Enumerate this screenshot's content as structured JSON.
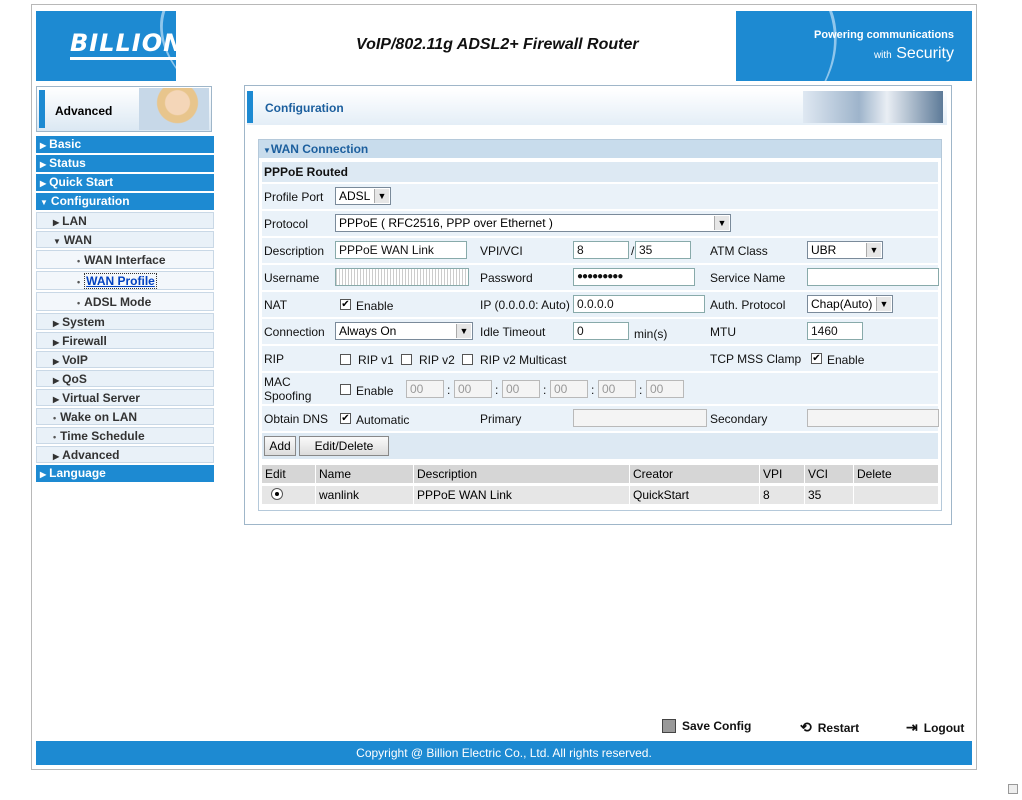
{
  "header": {
    "logo": "BILLION",
    "title": "VoIP/802.11g ADSL2+ Firewall Router",
    "tagline_line1": "Powering communications",
    "tagline_with": "with",
    "tagline_security": "Security"
  },
  "sidebar": {
    "mode_label": "Advanced",
    "items": [
      {
        "label": "Basic"
      },
      {
        "label": "Status"
      },
      {
        "label": "Quick Start"
      },
      {
        "label": "Configuration"
      },
      {
        "label": "LAN"
      },
      {
        "label": "WAN"
      },
      {
        "label": "WAN Interface"
      },
      {
        "label": "WAN Profile"
      },
      {
        "label": "ADSL Mode"
      },
      {
        "label": "System"
      },
      {
        "label": "Firewall"
      },
      {
        "label": "VoIP"
      },
      {
        "label": "QoS"
      },
      {
        "label": "Virtual Server"
      },
      {
        "label": "Wake on LAN"
      },
      {
        "label": "Time Schedule"
      },
      {
        "label": "Advanced"
      },
      {
        "label": "Language"
      }
    ]
  },
  "main": {
    "section_title": "Configuration",
    "panel_title": "WAN Connection",
    "subheading": "PPPoE Routed",
    "profile_port": {
      "label": "Profile Port",
      "value": "ADSL"
    },
    "protocol": {
      "label": "Protocol",
      "value": "PPPoE ( RFC2516, PPP over Ethernet )"
    },
    "description": {
      "label": "Description",
      "value": "PPPoE WAN Link"
    },
    "vpi_vci": {
      "label": "VPI/VCI",
      "vpi": "8",
      "sep": "/",
      "vci": "35"
    },
    "atm_class": {
      "label": "ATM Class",
      "value": "UBR"
    },
    "username": {
      "label": "Username"
    },
    "password": {
      "label": "Password",
      "value": "●●●●●●●●●"
    },
    "service_name": {
      "label": "Service Name",
      "value": ""
    },
    "nat": {
      "label": "NAT",
      "option": "Enable"
    },
    "ip": {
      "label": "IP (0.0.0.0: Auto)",
      "value": "0.0.0.0"
    },
    "auth_protocol": {
      "label": "Auth. Protocol",
      "value": "Chap(Auto)"
    },
    "connection": {
      "label": "Connection",
      "value": "Always On"
    },
    "idle_timeout": {
      "label": "Idle Timeout",
      "value": "0",
      "unit": "min(s)"
    },
    "mtu": {
      "label": "MTU",
      "value": "1460"
    },
    "rip": {
      "label": "RIP",
      "v1": "RIP v1",
      "v2": "RIP v2",
      "multicast": "RIP v2 Multicast"
    },
    "tcp_mss": {
      "label": "TCP MSS Clamp",
      "option": "Enable"
    },
    "mac_spoofing": {
      "label_line1": "MAC",
      "label_line2": "Spoofing",
      "option": "Enable",
      "octets": [
        "00",
        "00",
        "00",
        "00",
        "00",
        "00"
      ],
      "sep": ":"
    },
    "obtain_dns": {
      "label": "Obtain DNS",
      "option": "Automatic",
      "primary_label": "Primary",
      "secondary_label": "Secondary"
    },
    "buttons": {
      "add": "Add",
      "edit_delete": "Edit/Delete"
    },
    "table": {
      "headers": [
        "Edit",
        "Name",
        "Description",
        "Creator",
        "VPI",
        "VCI",
        "Delete"
      ],
      "rows": [
        {
          "name": "wanlink",
          "description": "PPPoE WAN Link",
          "creator": "QuickStart",
          "vpi": "8",
          "vci": "35"
        }
      ]
    }
  },
  "footer": {
    "save_config": "Save Config",
    "restart": "Restart",
    "logout": "Logout",
    "copyright": "Copyright @ Billion Electric Co., Ltd. All rights reserved."
  },
  "colors": {
    "accent": "#1d8ad2",
    "row_bg": "#eaf2f9",
    "title_blue": "#1c5f9e"
  }
}
